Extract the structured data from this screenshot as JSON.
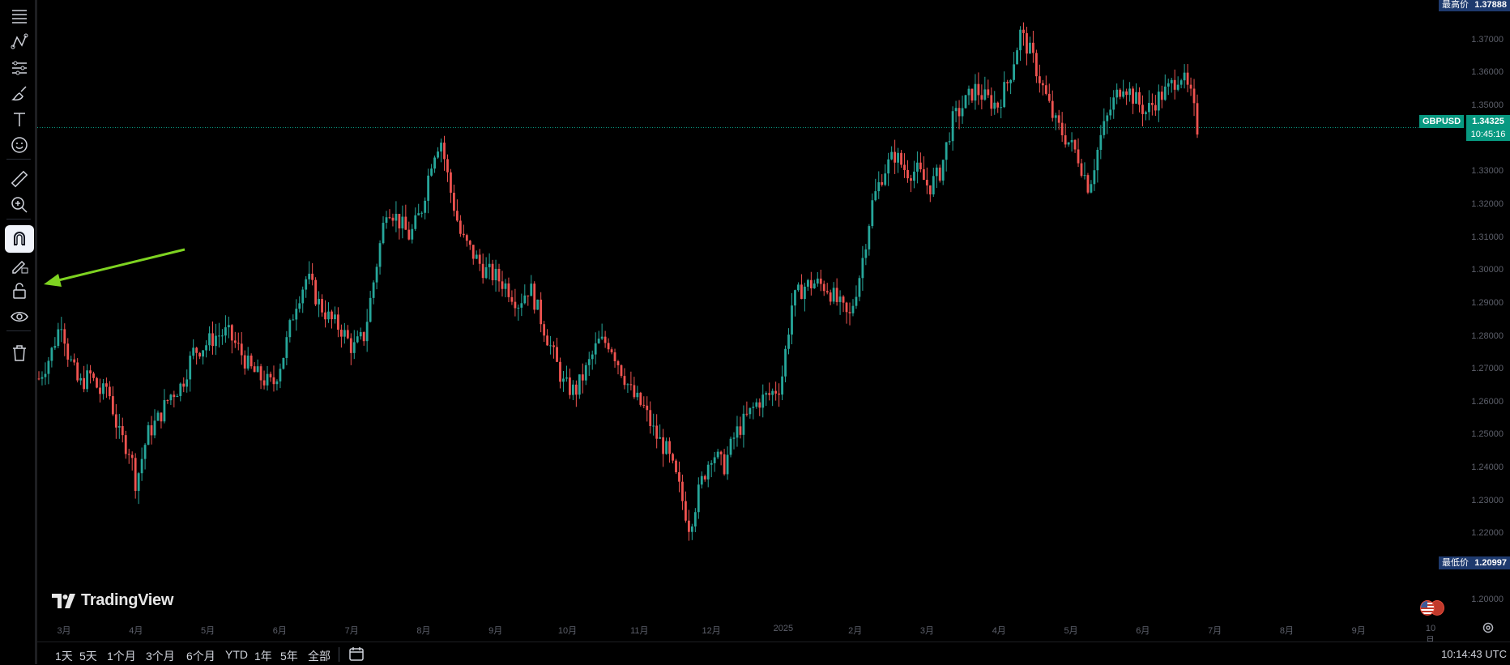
{
  "symbol": {
    "name": "GBPUSD",
    "price": "1.34325",
    "countdown": "10:45:16"
  },
  "price_labels": {
    "high_label": "最高价",
    "high_value": "1.37888",
    "low_label": "最低价",
    "low_value": "1.20997"
  },
  "price_axis": {
    "ticks": [
      "1.37000",
      "1.36000",
      "1.35000",
      "1.33000",
      "1.32000",
      "1.31000",
      "1.30000",
      "1.29000",
      "1.28000",
      "1.27000",
      "1.26000",
      "1.25000",
      "1.24000",
      "1.23000",
      "1.22000",
      "1.20000"
    ]
  },
  "time_axis": {
    "ticks": [
      "3月",
      "4月",
      "5月",
      "6月",
      "7月",
      "8月",
      "9月",
      "10月",
      "11月",
      "12月",
      "2025",
      "2月",
      "3月",
      "4月",
      "5月",
      "6月",
      "7月",
      "8月",
      "9月",
      "10月"
    ]
  },
  "range_buttons": [
    "1天",
    "5天",
    "1个月",
    "3个月",
    "6个月",
    "YTD",
    "1年",
    "5年",
    "全部"
  ],
  "clock": "10:14:43 UTC",
  "brand": "TradingView",
  "toolbar": {
    "tools": [
      "menu-icon",
      "pattern-icon",
      "lines-icon",
      "brush-icon",
      "text-icon",
      "emoji-icon",
      "ruler-icon",
      "zoom-icon",
      "magnet-icon",
      "pencil-lock-icon",
      "lock-icon",
      "eye-icon",
      "trash-icon"
    ]
  },
  "colors": {
    "up": "#26a69a",
    "down": "#ef5350",
    "accent_arrow": "#7ed321",
    "price_badge": "#089981",
    "range_badge": "#1e3a6e"
  },
  "chart_data": {
    "type": "candlestick",
    "symbol": "GBPUSD",
    "ylim": [
      1.195,
      1.382
    ],
    "last_price": 1.34325,
    "high": 1.37888,
    "low": 1.20997,
    "close_path": [
      [
        0,
        1.267
      ],
      [
        10,
        1.274
      ],
      [
        20,
        1.285
      ],
      [
        25,
        1.275
      ],
      [
        35,
        1.265
      ],
      [
        45,
        1.268
      ],
      [
        55,
        1.262
      ],
      [
        60,
        1.265
      ],
      [
        70,
        1.25
      ],
      [
        80,
        1.245
      ],
      [
        85,
        1.235
      ],
      [
        95,
        1.25
      ],
      [
        105,
        1.255
      ],
      [
        115,
        1.262
      ],
      [
        125,
        1.265
      ],
      [
        135,
        1.275
      ],
      [
        145,
        1.277
      ],
      [
        155,
        1.28
      ],
      [
        165,
        1.281
      ],
      [
        175,
        1.276
      ],
      [
        185,
        1.27
      ],
      [
        195,
        1.267
      ],
      [
        205,
        1.265
      ],
      [
        215,
        1.275
      ],
      [
        225,
        1.29
      ],
      [
        235,
        1.298
      ],
      [
        245,
        1.29
      ],
      [
        255,
        1.285
      ],
      [
        265,
        1.282
      ],
      [
        275,
        1.276
      ],
      [
        285,
        1.28
      ],
      [
        295,
        1.3
      ],
      [
        305,
        1.32
      ],
      [
        315,
        1.315
      ],
      [
        325,
        1.31
      ],
      [
        335,
        1.318
      ],
      [
        345,
        1.335
      ],
      [
        352,
        1.34
      ],
      [
        360,
        1.325
      ],
      [
        370,
        1.31
      ],
      [
        380,
        1.305
      ],
      [
        390,
        1.3
      ],
      [
        400,
        1.298
      ],
      [
        410,
        1.295
      ],
      [
        420,
        1.29
      ],
      [
        430,
        1.295
      ],
      [
        440,
        1.285
      ],
      [
        450,
        1.275
      ],
      [
        460,
        1.265
      ],
      [
        470,
        1.263
      ],
      [
        480,
        1.27
      ],
      [
        490,
        1.278
      ],
      [
        500,
        1.278
      ],
      [
        510,
        1.27
      ],
      [
        520,
        1.262
      ],
      [
        530,
        1.258
      ],
      [
        540,
        1.25
      ],
      [
        550,
        1.245
      ],
      [
        560,
        1.235
      ],
      [
        570,
        1.222
      ],
      [
        580,
        1.235
      ],
      [
        590,
        1.245
      ],
      [
        600,
        1.24
      ],
      [
        610,
        1.25
      ],
      [
        620,
        1.255
      ],
      [
        630,
        1.26
      ],
      [
        640,
        1.262
      ],
      [
        650,
        1.265
      ],
      [
        660,
        1.29
      ],
      [
        670,
        1.295
      ],
      [
        680,
        1.296
      ],
      [
        690,
        1.295
      ],
      [
        700,
        1.29
      ],
      [
        710,
        1.285
      ],
      [
        720,
        1.3
      ],
      [
        730,
        1.32
      ],
      [
        740,
        1.33
      ],
      [
        750,
        1.335
      ],
      [
        760,
        1.33
      ],
      [
        770,
        1.33
      ],
      [
        780,
        1.325
      ],
      [
        790,
        1.33
      ],
      [
        800,
        1.345
      ],
      [
        810,
        1.35
      ],
      [
        820,
        1.355
      ],
      [
        830,
        1.352
      ],
      [
        840,
        1.35
      ],
      [
        850,
        1.358
      ],
      [
        860,
        1.372
      ],
      [
        870,
        1.365
      ],
      [
        880,
        1.355
      ],
      [
        890,
        1.345
      ],
      [
        900,
        1.34
      ],
      [
        910,
        1.335
      ],
      [
        920,
        1.325
      ],
      [
        930,
        1.34
      ],
      [
        940,
        1.35
      ],
      [
        950,
        1.357
      ],
      [
        960,
        1.352
      ],
      [
        970,
        1.348
      ],
      [
        980,
        1.352
      ],
      [
        990,
        1.355
      ],
      [
        1000,
        1.36
      ],
      [
        1010,
        1.352
      ],
      [
        1015,
        1.343
      ]
    ]
  }
}
